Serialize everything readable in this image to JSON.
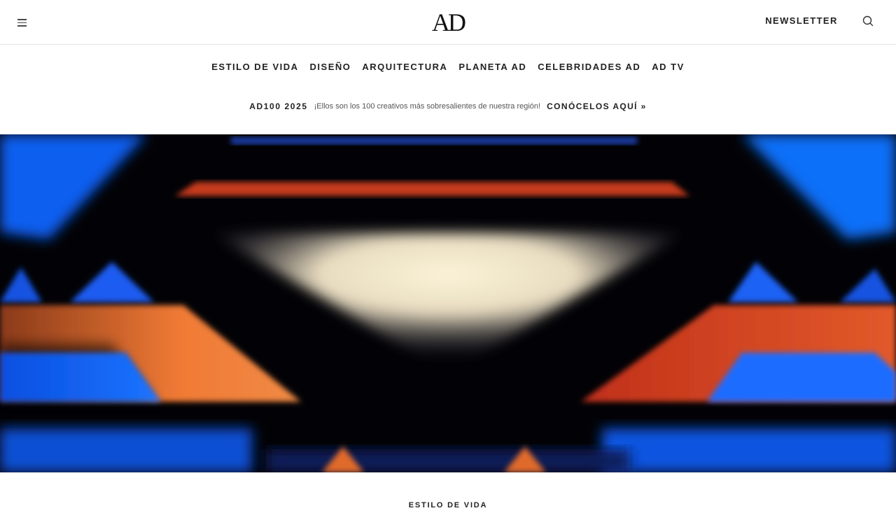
{
  "header": {
    "logo": "AD",
    "newsletter_label": "NEWSLETTER",
    "menu_icon": "hamburger-menu-icon",
    "search_icon": "search-icon"
  },
  "nav": {
    "items": [
      {
        "label": "ESTILO DE VIDA"
      },
      {
        "label": "DISEÑO"
      },
      {
        "label": "ARQUITECTURA"
      },
      {
        "label": "PLANETA AD"
      },
      {
        "label": "CELEBRIDADES AD"
      },
      {
        "label": "AD TV"
      }
    ]
  },
  "promo": {
    "label": "AD100 2025",
    "text": "¡Ellos son los 100 creativos más sobresalientes de nuestra región!",
    "link": "CONÓCELOS AQUÍ »"
  },
  "article": {
    "category": "ESTILO DE VIDA"
  },
  "colors": {
    "text": "#222222",
    "hero_blue": "#1a6cff",
    "hero_orange": "#e8642a",
    "hero_red": "#d8331e",
    "hero_cream": "#f3ead0"
  }
}
